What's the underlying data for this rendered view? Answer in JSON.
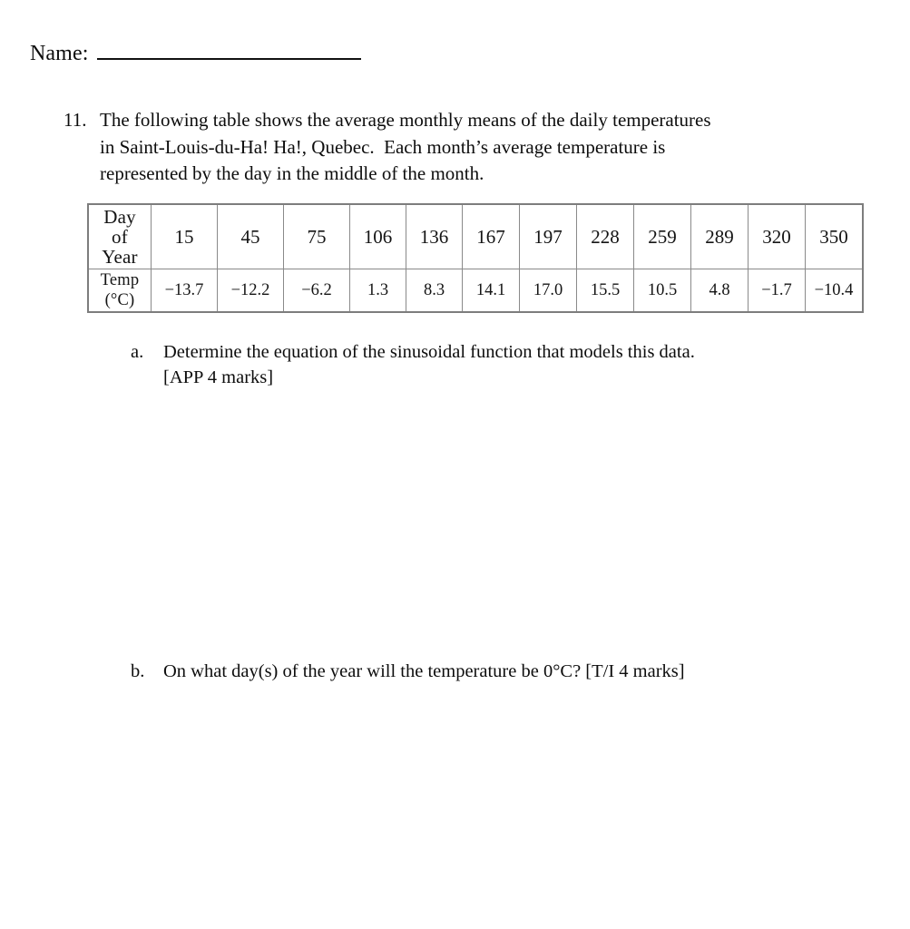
{
  "page": {
    "background_color": "#ffffff",
    "text_color": "#0d0d0d"
  },
  "name_field": {
    "label": "Name:",
    "value": ""
  },
  "question": {
    "number": "11.",
    "lines": [
      "The following table shows the average monthly means of the daily temperatures",
      "in Saint-Louis-du-Ha! Ha!, Quebec.  Each month’s average temperature is",
      "represented by the day in the middle of the month."
    ]
  },
  "chart_data": {
    "type": "table",
    "title": "Average monthly means of daily temperatures, Saint-Louis-du-Ha! Ha!, Quebec",
    "xlabel": "Day of Year",
    "ylabel": "Temp (°C)",
    "row_headers": [
      "Day of Year",
      "Temp (°C)"
    ],
    "row_header_lines": [
      [
        "Day",
        "of",
        "Year"
      ],
      [
        "Temp",
        "(°C)"
      ]
    ],
    "x": [
      15,
      45,
      75,
      106,
      136,
      167,
      197,
      228,
      259,
      289,
      320,
      350
    ],
    "values": [
      -13.7,
      -12.2,
      -6.2,
      1.3,
      8.3,
      14.1,
      17.0,
      15.5,
      10.5,
      4.8,
      -1.7,
      -10.4
    ],
    "day_labels": [
      "15",
      "45",
      "75",
      "106",
      "136",
      "167",
      "197",
      "228",
      "259",
      "289",
      "320",
      "350"
    ],
    "temp_labels": [
      "−13.7",
      "−12.2",
      "−6.2",
      "1.3",
      "8.3",
      "14.1",
      "17.0",
      "15.5",
      "10.5",
      "4.8",
      "−1.7",
      "−10.4"
    ],
    "grid": true,
    "border_color": "#7d7d7d"
  },
  "parts": [
    {
      "marker": "a.",
      "lines": [
        "Determine the equation of the sinusoidal function that models this data.",
        "[APP 4 marks]"
      ]
    },
    {
      "marker": "b.",
      "lines": [
        "On what day(s) of the year will the temperature be 0°C? [T/I 4 marks]"
      ]
    }
  ]
}
